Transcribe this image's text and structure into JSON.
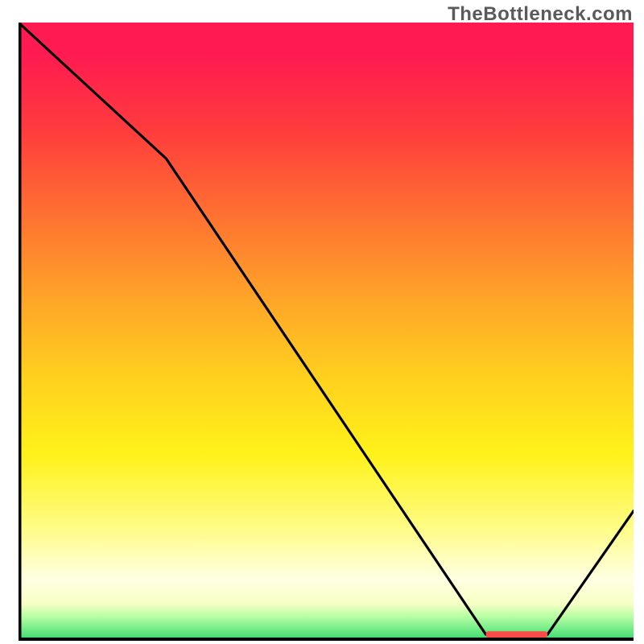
{
  "watermark": "TheBottleneck.com",
  "chart_data": {
    "type": "line",
    "title": "",
    "xlabel": "",
    "ylabel": "",
    "xlim": [
      0,
      100
    ],
    "ylim": [
      0,
      100
    ],
    "series": [
      {
        "name": "bottleneck-curve",
        "x": [
          0,
          24,
          76,
          86,
          100
        ],
        "values": [
          100,
          78,
          1,
          1,
          21
        ]
      }
    ],
    "marker": {
      "name": "optimum-zone",
      "color": "#ff4a4a",
      "x_range": [
        76,
        86
      ],
      "y": 1
    },
    "gradient_stops": [
      {
        "pos": 0.0,
        "color": "#ff1a52"
      },
      {
        "pos": 0.05,
        "color": "#ff1a52"
      },
      {
        "pos": 0.18,
        "color": "#ff3e3c"
      },
      {
        "pos": 0.33,
        "color": "#ff7830"
      },
      {
        "pos": 0.45,
        "color": "#ffa628"
      },
      {
        "pos": 0.58,
        "color": "#ffd21e"
      },
      {
        "pos": 0.7,
        "color": "#fff21a"
      },
      {
        "pos": 0.82,
        "color": "#fffc88"
      },
      {
        "pos": 0.9,
        "color": "#ffffe2"
      },
      {
        "pos": 0.94,
        "color": "#f8ffc5"
      },
      {
        "pos": 0.96,
        "color": "#b9ffa5"
      },
      {
        "pos": 0.99,
        "color": "#57e37a"
      },
      {
        "pos": 1.0,
        "color": "#23d571"
      }
    ]
  }
}
